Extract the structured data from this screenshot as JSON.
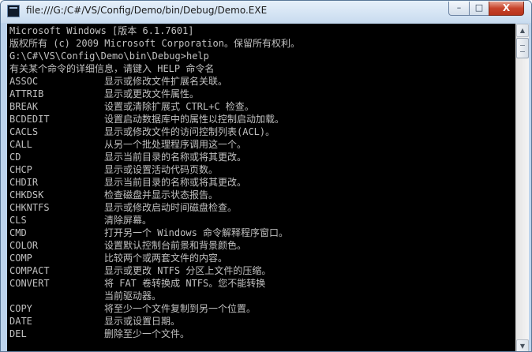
{
  "window": {
    "title": "file:///G:/C#/VS/Config/Demo/bin/Debug/Demo.EXE",
    "buttons": {
      "minimize": "–",
      "maximize": "□",
      "close": "X"
    }
  },
  "colors": {
    "console_bg": "#000000",
    "console_text": "#c0c0c0",
    "close_button": "#c7432b"
  },
  "console": {
    "header_lines": [
      "Microsoft Windows [版本 6.1.7601]",
      "版权所有 (c) 2009 Microsoft Corporation。保留所有权利。",
      "G:\\C#\\VS\\Config\\Demo\\bin\\Debug>help",
      "有关某个命令的详细信息，请键入 HELP 命令名"
    ],
    "commands": [
      {
        "name": "ASSOC",
        "desc": "显示或修改文件扩展名关联。"
      },
      {
        "name": "ATTRIB",
        "desc": "显示或更改文件属性。"
      },
      {
        "name": "BREAK",
        "desc": "设置或清除扩展式 CTRL+C 检查。"
      },
      {
        "name": "BCDEDIT",
        "desc": "设置启动数据库中的属性以控制启动加载。"
      },
      {
        "name": "CACLS",
        "desc": "显示或修改文件的访问控制列表(ACL)。"
      },
      {
        "name": "CALL",
        "desc": "从另一个批处理程序调用这一个。"
      },
      {
        "name": "CD",
        "desc": "显示当前目录的名称或将其更改。"
      },
      {
        "name": "CHCP",
        "desc": "显示或设置活动代码页数。"
      },
      {
        "name": "CHDIR",
        "desc": "显示当前目录的名称或将其更改。"
      },
      {
        "name": "CHKDSK",
        "desc": "检查磁盘并显示状态报告。"
      },
      {
        "name": "CHKNTFS",
        "desc": "显示或修改启动时间磁盘检查。"
      },
      {
        "name": "CLS",
        "desc": "清除屏幕。"
      },
      {
        "name": "CMD",
        "desc": "打开另一个 Windows 命令解释程序窗口。"
      },
      {
        "name": "COLOR",
        "desc": "设置默认控制台前景和背景颜色。"
      },
      {
        "name": "COMP",
        "desc": "比较两个或两套文件的内容。"
      },
      {
        "name": "COMPACT",
        "desc": "显示或更改 NTFS 分区上文件的压缩。"
      },
      {
        "name": "CONVERT",
        "desc": "将 FAT 卷转换成 NTFS。您不能转换"
      },
      {
        "name": "",
        "desc": "当前驱动器。"
      },
      {
        "name": "COPY",
        "desc": "将至少一个文件复制到另一个位置。"
      },
      {
        "name": "DATE",
        "desc": "显示或设置日期。"
      },
      {
        "name": "DEL",
        "desc": "删除至少一个文件。"
      }
    ]
  }
}
